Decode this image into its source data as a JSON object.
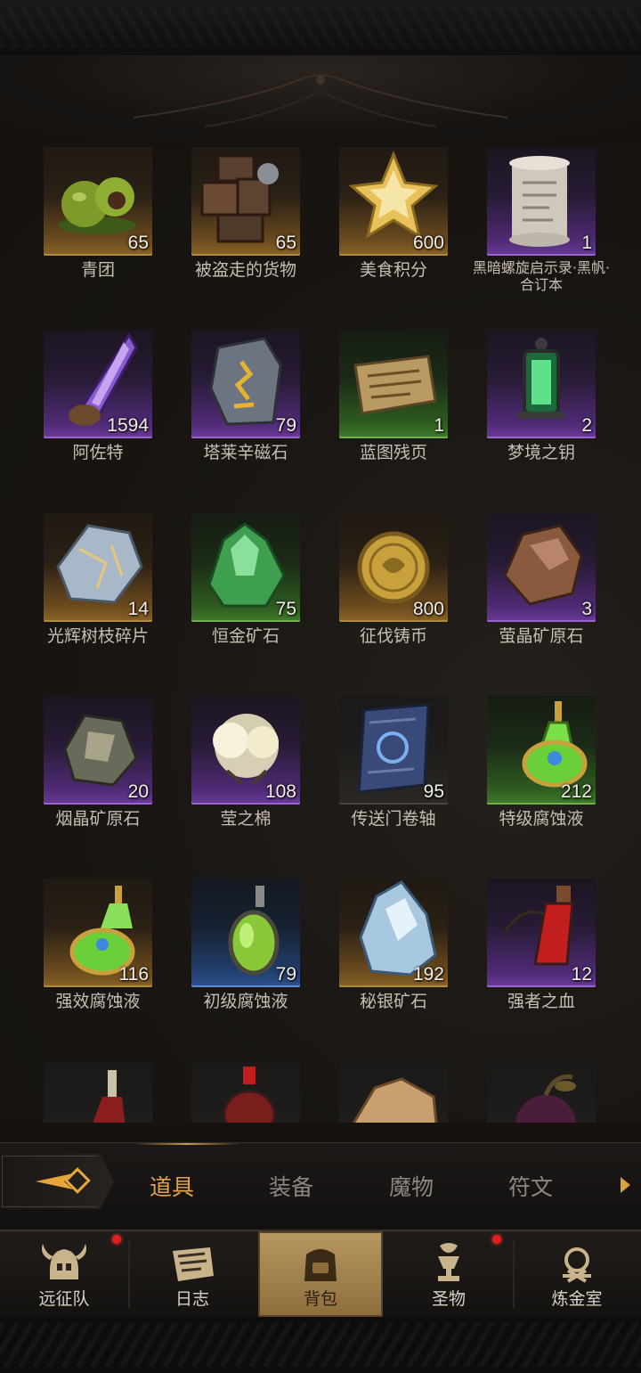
{
  "items": [
    {
      "name": "青团",
      "count": "65",
      "rarity": "gold",
      "icon": "qingtuan-icon"
    },
    {
      "name": "被盗走的货物",
      "count": "65",
      "rarity": "gold",
      "icon": "cargo-crates-icon"
    },
    {
      "name": "美食积分",
      "count": "600",
      "rarity": "gold",
      "icon": "gold-star-icon"
    },
    {
      "name": "黑暗螺旋启示录·黑帆·合订本",
      "count": "1",
      "rarity": "purple",
      "icon": "scroll-icon"
    },
    {
      "name": "阿佐特",
      "count": "1594",
      "rarity": "purple",
      "icon": "purple-crystal-icon"
    },
    {
      "name": "塔莱辛磁石",
      "count": "79",
      "rarity": "purple",
      "icon": "rune-stone-icon"
    },
    {
      "name": "蓝图残页",
      "count": "1",
      "rarity": "green",
      "icon": "blueprint-page-icon"
    },
    {
      "name": "梦境之钥",
      "count": "2",
      "rarity": "purple",
      "icon": "green-lantern-icon"
    },
    {
      "name": "光辉树枝碎片",
      "count": "14",
      "rarity": "gold",
      "icon": "silver-shard-icon"
    },
    {
      "name": "恒金矿石",
      "count": "75",
      "rarity": "green",
      "icon": "green-ore-icon"
    },
    {
      "name": "征伐铸币",
      "count": "800",
      "rarity": "gold",
      "icon": "gold-coin-icon"
    },
    {
      "name": "萤晶矿原石",
      "count": "3",
      "rarity": "purple",
      "icon": "brown-ore-icon"
    },
    {
      "name": "烟晶矿原石",
      "count": "20",
      "rarity": "purple",
      "icon": "smoky-ore-icon"
    },
    {
      "name": "莹之棉",
      "count": "108",
      "rarity": "purple",
      "icon": "cotton-icon"
    },
    {
      "name": "传送门卷轴",
      "count": "95",
      "rarity": "dark",
      "icon": "portal-scroll-icon"
    },
    {
      "name": "特级腐蚀液",
      "count": "212",
      "rarity": "green",
      "icon": "green-potion-icon"
    },
    {
      "name": "强效腐蚀液",
      "count": "116",
      "rarity": "gold",
      "icon": "green-flask-icon"
    },
    {
      "name": "初级腐蚀液",
      "count": "79",
      "rarity": "blue",
      "icon": "green-bottle-icon"
    },
    {
      "name": "秘银矿石",
      "count": "192",
      "rarity": "gold",
      "icon": "mithril-ore-icon"
    },
    {
      "name": "强者之血",
      "count": "12",
      "rarity": "purple",
      "icon": "blood-vial-icon"
    },
    {
      "name": "",
      "count": "",
      "rarity": "dark",
      "icon": "red-potion-icon"
    },
    {
      "name": "",
      "count": "",
      "rarity": "dark",
      "icon": "red-flask-icon"
    },
    {
      "name": "",
      "count": "",
      "rarity": "dark",
      "icon": "hide-leather-icon"
    },
    {
      "name": "",
      "count": "",
      "rarity": "dark",
      "icon": "dark-fruit-icon"
    }
  ],
  "tabs": {
    "active": "道具",
    "list": [
      "道具",
      "装备",
      "魔物",
      "符文"
    ]
  },
  "nav": {
    "expedition": "远征队",
    "journal": "日志",
    "backpack": "背包",
    "relic": "圣物",
    "alchemy": "炼金室"
  },
  "colors": {
    "accent_gold": "#e3a54a",
    "rarity_gold": "#8a6326",
    "rarity_purple": "#6a3a98",
    "rarity_green": "#3f7d2a",
    "rarity_blue": "#2c5292",
    "notification": "#e11f1f"
  }
}
